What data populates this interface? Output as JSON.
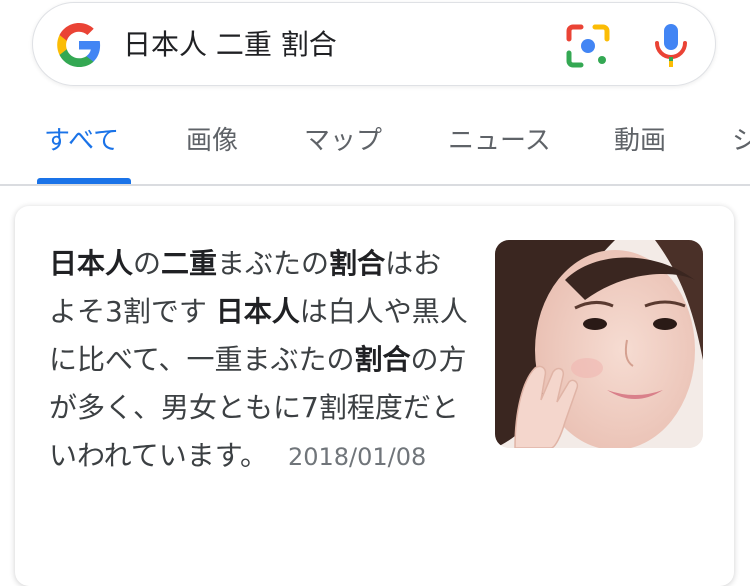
{
  "search": {
    "query": "日本人 二重 割合"
  },
  "tabs": [
    {
      "label": "すべて",
      "active": true
    },
    {
      "label": "画像",
      "active": false
    },
    {
      "label": "マップ",
      "active": false
    },
    {
      "label": "ニュース",
      "active": false
    },
    {
      "label": "動画",
      "active": false
    },
    {
      "label": "シ",
      "active": false
    }
  ],
  "result": {
    "segments": [
      {
        "text": "日本人",
        "bold": true
      },
      {
        "text": "の",
        "bold": false
      },
      {
        "text": "二重",
        "bold": true
      },
      {
        "text": "まぶたの",
        "bold": false
      },
      {
        "text": "割合",
        "bold": true
      },
      {
        "text": "はおよそ3割です ",
        "bold": false
      },
      {
        "text": "日本人",
        "bold": true
      },
      {
        "text": "は白人や黒人に比べて、一重まぶたの",
        "bold": false
      },
      {
        "text": "割合",
        "bold": true
      },
      {
        "text": "の方が多く、男女ともに7割程度だといわれています。",
        "bold": false
      }
    ],
    "date": "2018/01/08"
  },
  "colors": {
    "accent": "#1a73e8",
    "text": "#3c4043",
    "muted": "#70757a"
  },
  "icons": [
    "google-g-icon",
    "google-lens-icon",
    "microphone-icon"
  ]
}
